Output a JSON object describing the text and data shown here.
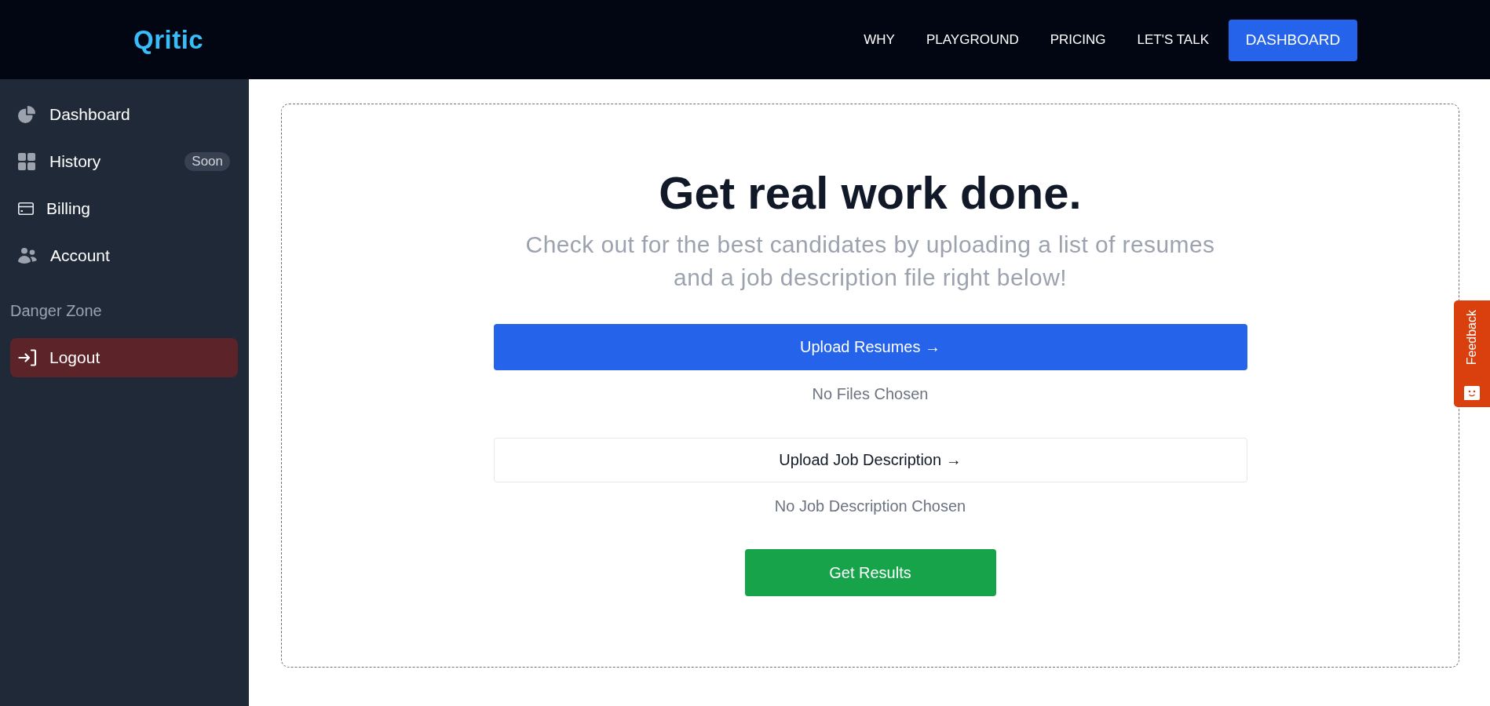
{
  "top_bar": {
    "logo": "Qritic",
    "nav_links": [
      "WHY",
      "PLAYGROUND",
      "PRICING",
      "LET'S TALK"
    ],
    "cta_button": "DASHBOARD"
  },
  "sidebar": {
    "items": [
      {
        "label": "Dashboard"
      },
      {
        "label": "History",
        "badge": "Soon"
      },
      {
        "label": "Billing"
      },
      {
        "label": "Account"
      }
    ],
    "section_title": "Danger Zone",
    "logout_button": "Logout"
  },
  "upload_card": {
    "title": "Get real work done.",
    "subtitle": "Check out for the best candidates by uploading a list of resumes and a job description file right below!",
    "uploads": [
      {
        "kind": "primary",
        "label": "Upload Resumes →",
        "status": "No Files Chosen"
      },
      {
        "kind": "outline",
        "label": "Upload Job Description →",
        "status": "No Job Description Chosen"
      }
    ],
    "submit_button": "Get Results"
  },
  "feedback_tab": {
    "label": "Feedback"
  }
}
